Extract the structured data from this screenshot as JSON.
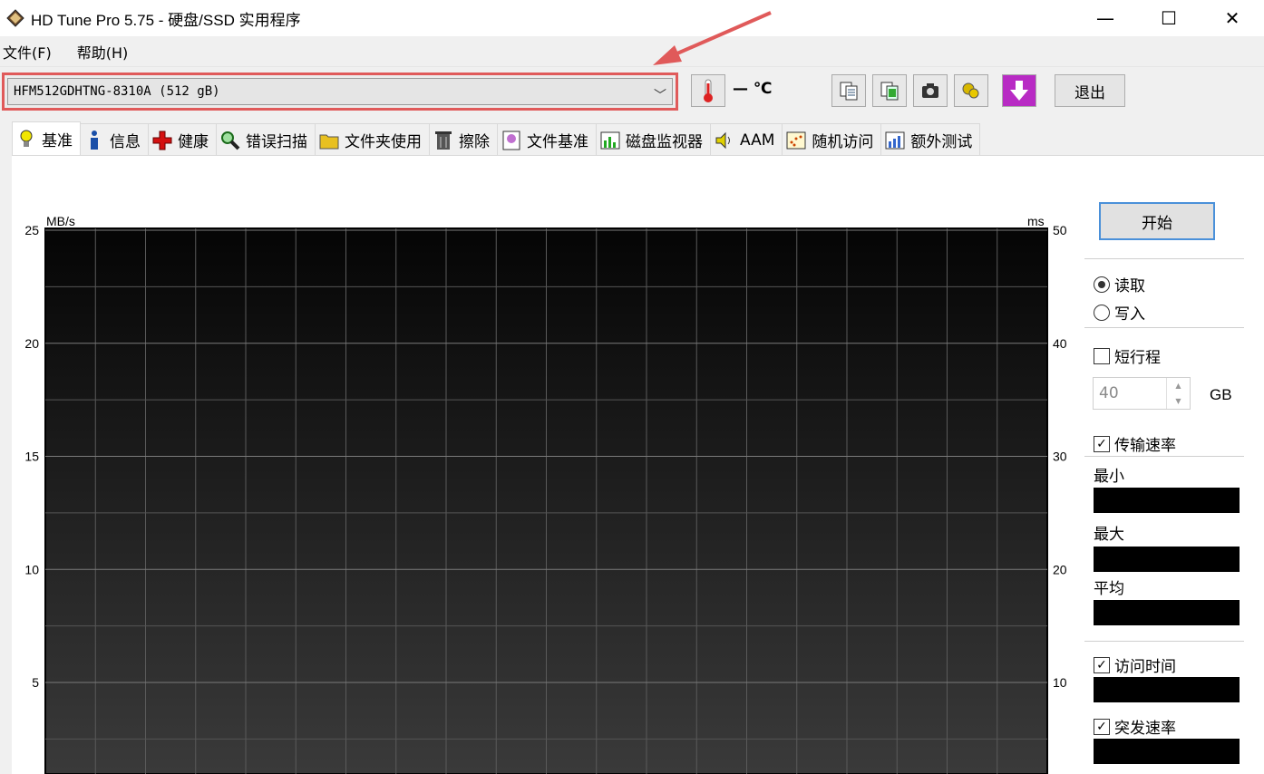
{
  "window": {
    "title": "HD Tune Pro 5.75 - 硬盘/SSD 实用程序",
    "minimize": "—",
    "maximize": "☐",
    "close": "✕"
  },
  "menu": {
    "file": "文件(F)",
    "help": "帮助(H)"
  },
  "toolbar": {
    "drive": "HFM512GDHTNG-8310A (512 gB)",
    "temperature": "— ℃",
    "exit_label": "退出"
  },
  "tabs": [
    {
      "label": "基准",
      "icon": "bulb-icon"
    },
    {
      "label": "信息",
      "icon": "info-icon"
    },
    {
      "label": "健康",
      "icon": "health-cross-icon"
    },
    {
      "label": "错误扫描",
      "icon": "magnifier-icon"
    },
    {
      "label": "文件夹使用",
      "icon": "folder-icon"
    },
    {
      "label": "擦除",
      "icon": "trash-icon"
    },
    {
      "label": "文件基准",
      "icon": "file-bulb-icon"
    },
    {
      "label": "磁盘监视器",
      "icon": "monitor-chart-icon"
    },
    {
      "label": "AAM",
      "icon": "speaker-icon"
    },
    {
      "label": "随机访问",
      "icon": "scatter-icon"
    },
    {
      "label": "额外测试",
      "icon": "extra-chart-icon"
    }
  ],
  "chart_data": {
    "type": "line",
    "ylabel_left": "MB/s",
    "ylabel_right": "ms",
    "y_left_ticks": [
      "25",
      "20",
      "15",
      "10",
      "5"
    ],
    "y_right_ticks": [
      "50",
      "40",
      "30",
      "20",
      "10"
    ],
    "ylim_left": [
      0,
      25
    ],
    "ylim_right": [
      0,
      50
    ],
    "grid": true,
    "series": []
  },
  "side": {
    "start_label": "开始",
    "read_label": "读取",
    "write_label": "写入",
    "short_stroke_label": "短行程",
    "short_stroke_value": "40",
    "short_stroke_unit": "GB",
    "transfer_rate_label": "传输速率",
    "min_label": "最小",
    "max_label": "最大",
    "avg_label": "平均",
    "access_time_label": "访问时间",
    "burst_rate_label": "突发速率"
  },
  "colors": {
    "annotation": "#e05a5a",
    "chart_bg_top": "#050505",
    "chart_bg_bottom": "#3a3a3a"
  }
}
